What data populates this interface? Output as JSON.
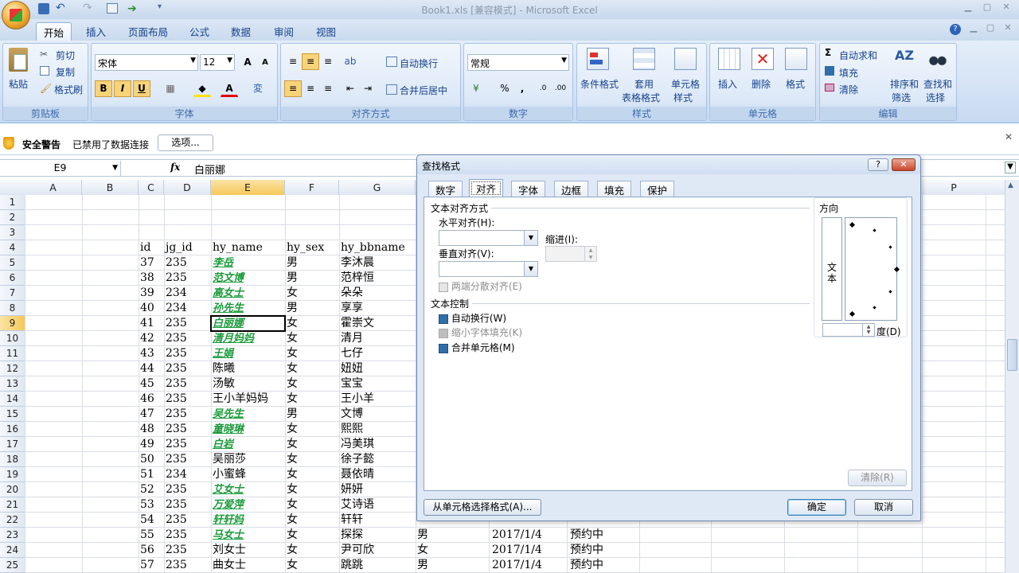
{
  "window": {
    "title": "Book1.xls  [兼容模式] - Microsoft Excel"
  },
  "ribbon": {
    "tabs": [
      "开始",
      "插入",
      "页面布局",
      "公式",
      "数据",
      "审阅",
      "视图"
    ],
    "clipboard": {
      "paste": "粘贴",
      "cut": "剪切",
      "copy": "复制",
      "format_painter": "格式刷",
      "label": "剪贴板"
    },
    "font": {
      "name": "宋体",
      "size": "12",
      "label": "字体"
    },
    "alignment": {
      "wrap": "自动换行",
      "merge": "合并后居中",
      "label": "对齐方式"
    },
    "number": {
      "format": "常规",
      "label": "数字"
    },
    "styles": {
      "conditional": "条件格式",
      "table_line1": "套用",
      "table_line2": "表格格式",
      "cell_line1": "单元格",
      "cell_line2": "样式",
      "label": "样式"
    },
    "cells": {
      "insert": "插入",
      "delete": "删除",
      "format": "格式",
      "label": "单元格"
    },
    "editing": {
      "autosum": "自动求和",
      "fill": "填充",
      "clear": "清除",
      "sort_line1": "排序和",
      "sort_line2": "筛选",
      "find_line1": "查找和",
      "find_line2": "选择",
      "label": "编辑"
    }
  },
  "security": {
    "title": "安全警告",
    "message": "已禁用了数据连接",
    "options": "选项..."
  },
  "formula_bar": {
    "name_box": "E9",
    "fx": "fx",
    "content": "白丽娜"
  },
  "columns": [
    "A",
    "B",
    "C",
    "D",
    "E",
    "F",
    "G",
    "P"
  ],
  "rows": [
    {
      "n": "1",
      "id": "",
      "jg": "",
      "name": "",
      "sex": "",
      "bb": "",
      "hl": false
    },
    {
      "n": "2",
      "id": "",
      "jg": "",
      "name": "",
      "sex": "",
      "bb": "",
      "hl": false
    },
    {
      "n": "3",
      "id": "",
      "jg": "",
      "name": "",
      "sex": "",
      "bb": "",
      "hl": false
    },
    {
      "n": "4",
      "id": "id",
      "jg": "jg_id",
      "name": "hy_name",
      "sex": "hy_sex",
      "bb": "hy_bbname",
      "hl": false
    },
    {
      "n": "5",
      "id": "37",
      "jg": "235",
      "name": "李岳",
      "sex": "男",
      "bb": "李沐晨",
      "hl": true
    },
    {
      "n": "6",
      "id": "38",
      "jg": "235",
      "name": "范文博",
      "sex": "男",
      "bb": "范梓恒",
      "hl": true
    },
    {
      "n": "7",
      "id": "39",
      "jg": "234",
      "name": "高女士",
      "sex": "女",
      "bb": "朵朵",
      "hl": true
    },
    {
      "n": "8",
      "id": "40",
      "jg": "234",
      "name": "孙先生",
      "sex": "男",
      "bb": "享享",
      "hl": true
    },
    {
      "n": "9",
      "id": "41",
      "jg": "235",
      "name": "白丽娜",
      "sex": "女",
      "bb": "霍崇文",
      "hl": true
    },
    {
      "n": "10",
      "id": "42",
      "jg": "235",
      "name": "清月妈妈",
      "sex": "女",
      "bb": "清月",
      "hl": true
    },
    {
      "n": "11",
      "id": "43",
      "jg": "235",
      "name": "王娟",
      "sex": "女",
      "bb": "七仔",
      "hl": true
    },
    {
      "n": "12",
      "id": "44",
      "jg": "235",
      "name": "陈曦",
      "sex": "女",
      "bb": "妞妞",
      "hl": false
    },
    {
      "n": "13",
      "id": "45",
      "jg": "235",
      "name": "汤敏",
      "sex": "女",
      "bb": "宝宝",
      "hl": false
    },
    {
      "n": "14",
      "id": "46",
      "jg": "235",
      "name": "王小羊妈妈",
      "sex": "女",
      "bb": "王小羊",
      "hl": false
    },
    {
      "n": "15",
      "id": "47",
      "jg": "235",
      "name": "吴先生",
      "sex": "男",
      "bb": "文博",
      "hl": true
    },
    {
      "n": "16",
      "id": "48",
      "jg": "235",
      "name": "童晓琳",
      "sex": "女",
      "bb": "熙熙",
      "hl": true
    },
    {
      "n": "17",
      "id": "49",
      "jg": "235",
      "name": "白岩",
      "sex": "女",
      "bb": "冯美琪",
      "hl": true
    },
    {
      "n": "18",
      "id": "50",
      "jg": "235",
      "name": "吴丽莎",
      "sex": "女",
      "bb": "徐子懿",
      "hl": false
    },
    {
      "n": "19",
      "id": "51",
      "jg": "234",
      "name": "小蜜蜂",
      "sex": "女",
      "bb": "聂依晴",
      "hl": false
    },
    {
      "n": "20",
      "id": "52",
      "jg": "235",
      "name": "艾女士",
      "sex": "女",
      "bb": "妍妍",
      "hl": true
    },
    {
      "n": "21",
      "id": "53",
      "jg": "235",
      "name": "万爱萍",
      "sex": "女",
      "bb": "艾诗语",
      "hl": true
    },
    {
      "n": "22",
      "id": "54",
      "jg": "235",
      "name": "轩轩妈",
      "sex": "女",
      "bb": "轩轩",
      "hl": true
    },
    {
      "n": "23",
      "id": "55",
      "jg": "235",
      "name": "马女士",
      "sex": "女",
      "bb": "探探",
      "hl": true
    },
    {
      "n": "24",
      "id": "56",
      "jg": "235",
      "name": "刘女士",
      "sex": "女",
      "bb": "尹可欣",
      "hl": false
    },
    {
      "n": "25",
      "id": "57",
      "jg": "235",
      "name": "曲女士",
      "sex": "女",
      "bb": "跳跳",
      "hl": false
    }
  ],
  "extra_rows": [
    {
      "n": "23",
      "h": "男",
      "i": "2017/1/4",
      "j": "预约中"
    },
    {
      "n": "24",
      "h": "女",
      "i": "2017/1/4",
      "j": "预约中"
    },
    {
      "n": "25",
      "h": "男",
      "i": "2017/1/4",
      "j": "预约中"
    }
  ],
  "dialog": {
    "title": "查找格式",
    "tabs": [
      "数字",
      "对齐",
      "字体",
      "边框",
      "填充",
      "保护"
    ],
    "text_alignment": "文本对齐方式",
    "horizontal": "水平对齐(H):",
    "indent": "缩进(I):",
    "vertical": "垂直对齐(V):",
    "distributed": "两端分散对齐(E)",
    "text_control": "文本控制",
    "wrap": "自动换行(W)",
    "shrink": "缩小字体填充(K)",
    "merge": "合并单元格(M)",
    "orientation": "方向",
    "orientation_text": "文本",
    "degrees": "度(D)",
    "clear": "清除(R)",
    "from_cell": "从单元格选择格式(A)...",
    "ok": "确定",
    "cancel": "取消"
  }
}
